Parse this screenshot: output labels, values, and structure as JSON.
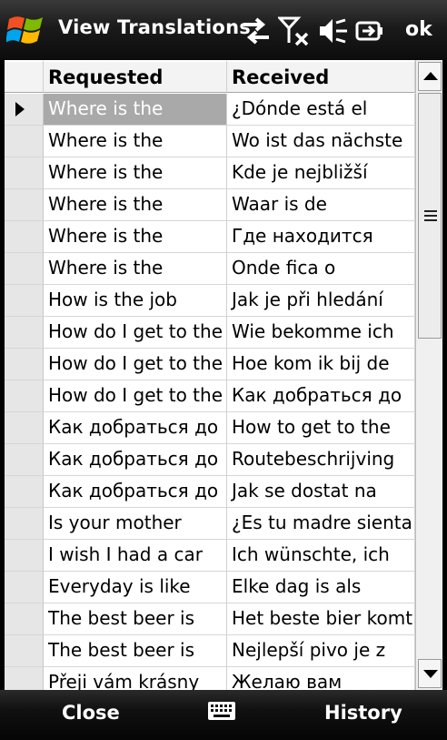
{
  "titlebar": {
    "title": "View Translations",
    "ok_label": "ok",
    "icons": [
      "windows-start-icon",
      "sync-arrows-icon",
      "no-signal-icon",
      "volume-muted-icon",
      "battery-charging-icon"
    ]
  },
  "grid": {
    "columns": [
      "Requested",
      "Received"
    ],
    "selected_row": 0,
    "rows": [
      {
        "requested": "Where is the",
        "received": "¿Dónde está el"
      },
      {
        "requested": "Where is the",
        "received": "Wo ist das nächste"
      },
      {
        "requested": "Where is the",
        "received": "Kde je nejbližší"
      },
      {
        "requested": "Where is the",
        "received": "Waar is de"
      },
      {
        "requested": "Where is the",
        "received": "Где находится"
      },
      {
        "requested": "Where is the",
        "received": "Onde fica o"
      },
      {
        "requested": "How is the job",
        "received": "Jak je při hledání"
      },
      {
        "requested": "How do I get to the",
        "received": "Wie bekomme ich"
      },
      {
        "requested": "How do I get to the",
        "received": "Hoe kom ik bij de"
      },
      {
        "requested": "How do I get to the",
        "received": "Как добраться до"
      },
      {
        "requested": "Как добраться до",
        "received": "How to get to the"
      },
      {
        "requested": "Как добраться до",
        "received": "Routebeschrijving"
      },
      {
        "requested": "Как добраться до",
        "received": "Jak se dostat na"
      },
      {
        "requested": "Is your mother",
        "received": "¿Es tu madre sienta"
      },
      {
        "requested": "I wish I had a car",
        "received": "Ich wünschte, ich"
      },
      {
        "requested": "Everyday is like",
        "received": "Elke dag is als"
      },
      {
        "requested": "The best beer is",
        "received": "Het beste bier komt"
      },
      {
        "requested": "The best beer is",
        "received": "Nejlepší pivo je z"
      },
      {
        "requested": "Přeji vám krásny",
        "received": "Желаю вам"
      }
    ]
  },
  "bottombar": {
    "left_softkey": "Close",
    "right_softkey": "History",
    "center_icon": "keyboard-icon"
  }
}
